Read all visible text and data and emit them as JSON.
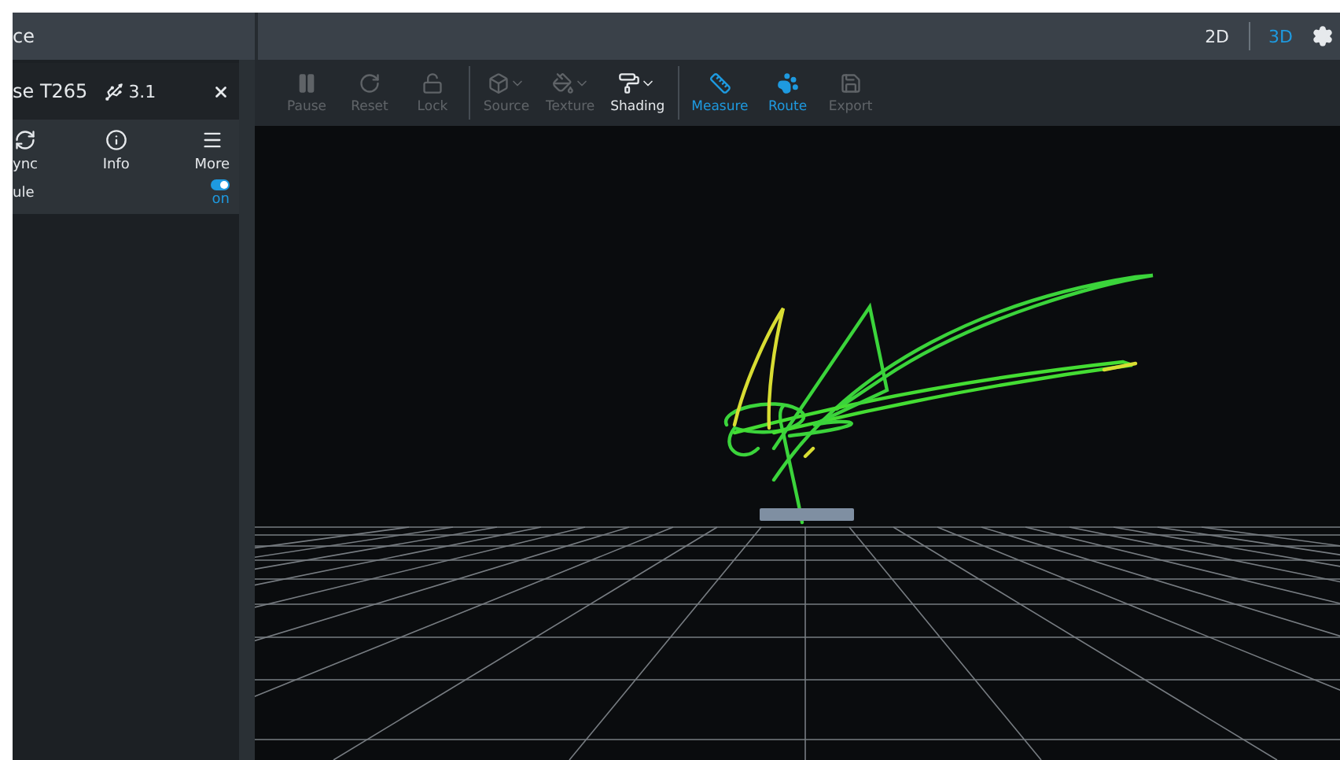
{
  "title": "ce",
  "view_modes": [
    {
      "label": "2D",
      "selected": false
    },
    {
      "label": "3D",
      "selected": true
    }
  ],
  "device": {
    "name": "se T265",
    "usb": "3.1",
    "actions": [
      {
        "label": "ync",
        "kind": "sync"
      },
      {
        "label": "Info",
        "kind": "info"
      },
      {
        "label": "More",
        "kind": "more"
      }
    ],
    "module": {
      "label": "ule",
      "on": true,
      "state_text": "on"
    }
  },
  "toolbar": [
    [
      {
        "label": "Pause",
        "kind": "pause",
        "disabled": true,
        "active": false,
        "dropdown": false
      },
      {
        "label": "Reset",
        "kind": "reset",
        "disabled": true,
        "active": false,
        "dropdown": false
      },
      {
        "label": "Lock",
        "kind": "lock",
        "disabled": true,
        "active": false,
        "dropdown": false
      }
    ],
    [
      {
        "label": "Source",
        "kind": "source",
        "disabled": true,
        "active": false,
        "dropdown": true
      },
      {
        "label": "Texture",
        "kind": "texture",
        "disabled": true,
        "active": false,
        "dropdown": true
      },
      {
        "label": "Shading",
        "kind": "shading",
        "disabled": false,
        "active": false,
        "dropdown": true
      }
    ],
    [
      {
        "label": "Measure",
        "kind": "measure",
        "disabled": false,
        "active": true,
        "dropdown": false
      },
      {
        "label": "Route",
        "kind": "route",
        "disabled": false,
        "active": true,
        "dropdown": false
      },
      {
        "label": "Export",
        "kind": "export",
        "disabled": true,
        "active": false,
        "dropdown": false
      }
    ]
  ]
}
